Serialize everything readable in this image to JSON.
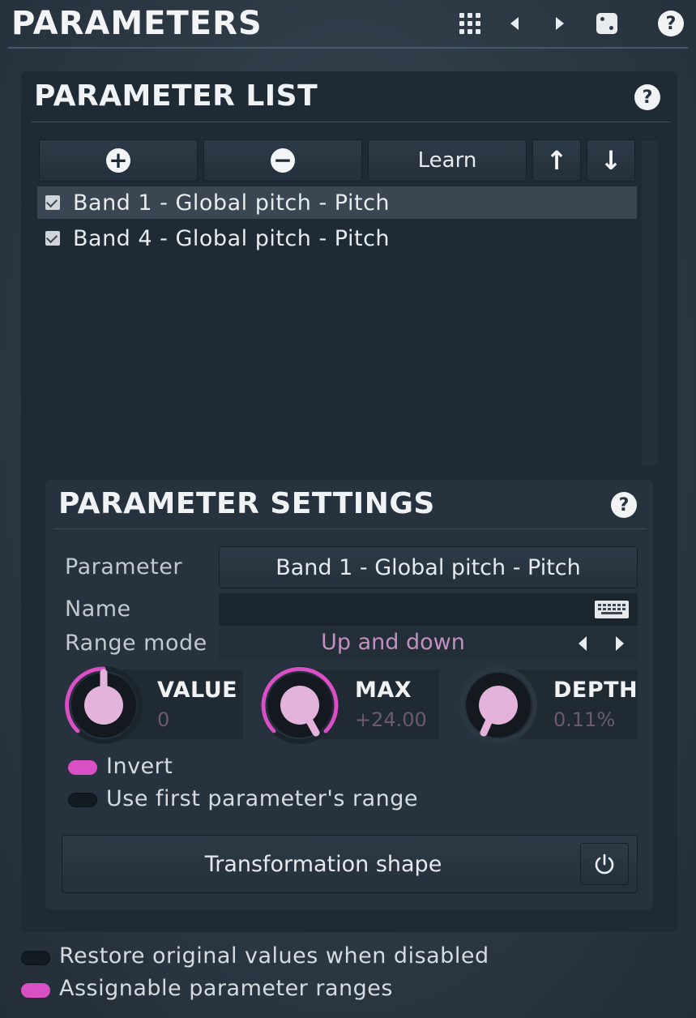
{
  "header": {
    "title": "PARAMETERS",
    "icons": [
      "grid-icon",
      "previous-icon",
      "next-icon",
      "randomize-icon",
      "help-icon"
    ],
    "help_symbol": "?"
  },
  "parameter_list": {
    "title": "PARAMETER LIST",
    "help_symbol": "?",
    "toolbar": {
      "add_symbol": "+",
      "remove_symbol": "−",
      "learn_label": "Learn",
      "up_symbol": "↑",
      "down_symbol": "↓"
    },
    "items": [
      {
        "label": "Band 1 - Global pitch - Pitch",
        "checked": true,
        "selected": true
      },
      {
        "label": "Band 4 - Global pitch - Pitch",
        "checked": true,
        "selected": false
      }
    ]
  },
  "parameter_settings": {
    "title": "PARAMETER SETTINGS",
    "help_symbol": "?",
    "parameter_label": "Parameter",
    "parameter_value": "Band 1 - Global pitch - Pitch",
    "name_label": "Name",
    "name_value": "",
    "range_mode_label": "Range mode",
    "range_mode_value": "Up and down",
    "knobs": [
      {
        "title": "VALUE",
        "value": "0"
      },
      {
        "title": "MAX",
        "value": "+24.00"
      },
      {
        "title": "DEPTH",
        "value": "0.11%"
      }
    ],
    "invert_label": "Invert",
    "invert_on": true,
    "use_first_range_label": "Use first parameter's range",
    "use_first_range_on": false,
    "transformation_shape_label": "Transformation shape"
  },
  "footer": {
    "restore_label": "Restore original values when disabled",
    "restore_on": false,
    "assignable_label": "Assignable parameter ranges",
    "assignable_on": true
  },
  "colors": {
    "accent_pink": "#d94fc4",
    "knob_face": "#e3b3dc",
    "background": "#2c3945",
    "panel": "#1e2a34"
  }
}
